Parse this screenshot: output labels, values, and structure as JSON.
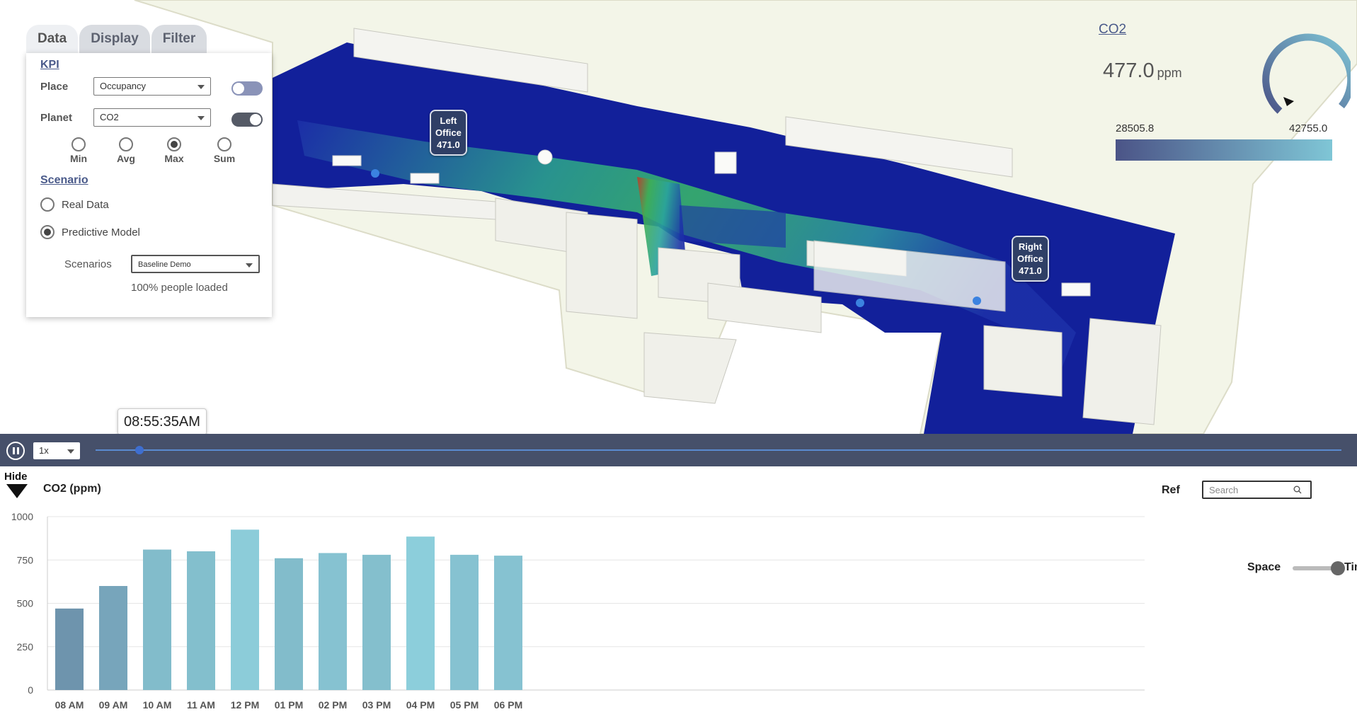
{
  "tabs": [
    {
      "label": "Data"
    },
    {
      "label": "Display"
    },
    {
      "label": "Filter"
    }
  ],
  "kpi": {
    "section_title": "KPI",
    "place": {
      "label": "Place",
      "value": "Occupancy",
      "toggle_on": false
    },
    "planet": {
      "label": "Planet",
      "value": "CO2",
      "toggle_on": true
    },
    "aggregations": [
      "Min",
      "Avg",
      "Max",
      "Sum"
    ],
    "selected_aggregation": "Max"
  },
  "scenario": {
    "section_title": "Scenario",
    "options": [
      "Real Data",
      "Predictive Model"
    ],
    "selected": "Predictive Model",
    "scenarios_label": "Scenarios",
    "scenarios_value": "Baseline Demo",
    "loaded_text": "100% people loaded"
  },
  "floor_labels": [
    {
      "lines": [
        "Left",
        "Office",
        "471.0"
      ]
    },
    {
      "lines": [
        "Right",
        "Office",
        "471.0"
      ]
    }
  ],
  "metric": {
    "title": "CO2",
    "value": "477.0",
    "unit": "ppm",
    "range_min": "28505.8",
    "range_max": "42755.0",
    "gradient": [
      "#4b5487",
      "#7fc6d6"
    ]
  },
  "timeline": {
    "current_time": "08:55:35AM",
    "speed": "1x",
    "progress": 0.035
  },
  "bottom": {
    "hide_label": "Hide",
    "ref_label": "Ref",
    "search_placeholder": "Search",
    "space_label": "Space",
    "time_label": "Time"
  },
  "chart_data": {
    "type": "bar",
    "title": "CO2 (ppm)",
    "categories": [
      "08 AM",
      "09 AM",
      "10 AM",
      "11 AM",
      "12 PM",
      "01 PM",
      "02 PM",
      "03 PM",
      "04 PM",
      "05 PM",
      "06 PM"
    ],
    "values": [
      470,
      600,
      810,
      800,
      925,
      760,
      790,
      780,
      885,
      780,
      775
    ],
    "ylim": [
      0,
      1000
    ],
    "yticks": [
      0,
      250,
      500,
      750,
      1000
    ],
    "grid": true,
    "colors": [
      "#6e94ad",
      "#77a5bb",
      "#82bccb",
      "#83bfcd",
      "#8cccd9",
      "#82bccb",
      "#86c2d1",
      "#84bfcd",
      "#8ccedb",
      "#86c2d1",
      "#86c2d1"
    ]
  }
}
